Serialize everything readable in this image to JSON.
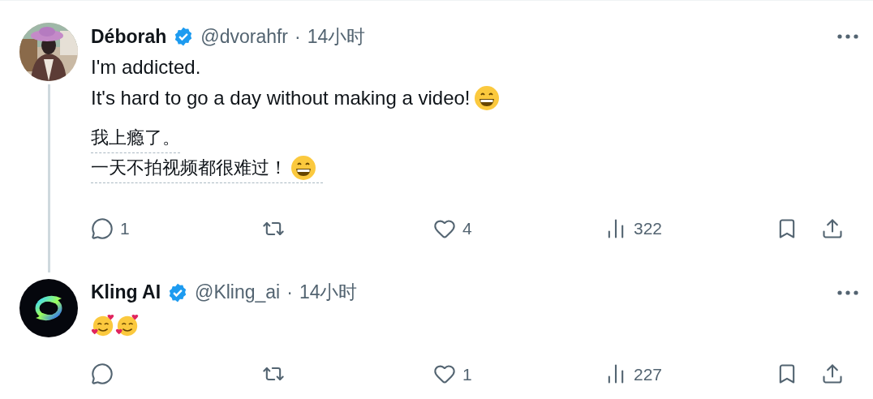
{
  "tweets": [
    {
      "avatar": {
        "kind": "picture"
      },
      "name": "Déborah",
      "verified": true,
      "handle": "@dvorahfr",
      "separator": "·",
      "time": "14小时",
      "thread_line": true,
      "body": [
        [
          {
            "kind": "text",
            "text": "I'm addicted."
          }
        ],
        [
          {
            "kind": "text",
            "text": "It's hard to go a day without making a video!"
          },
          {
            "kind": "grin_emoji"
          }
        ]
      ],
      "translation": [
        [
          {
            "kind": "text",
            "text": "我上瘾了。"
          }
        ],
        [
          {
            "kind": "text",
            "text": "一天不拍视频都很难过！"
          },
          {
            "kind": "grin_emoji"
          }
        ]
      ],
      "actions": [
        {
          "kind": "reply",
          "count": "1"
        },
        {
          "kind": "repost"
        },
        {
          "kind": "like",
          "count": "4"
        },
        {
          "kind": "views",
          "count": "322"
        },
        {
          "kind": "bookmark"
        },
        {
          "kind": "share"
        }
      ]
    },
    {
      "avatar": {
        "kind": "logo"
      },
      "name": "Kling AI",
      "verified": true,
      "handle": "@Kling_ai",
      "separator": "·",
      "time": "14小时",
      "thread_line": false,
      "body": [
        [
          {
            "kind": "hearts_emoji"
          },
          {
            "kind": "hearts_emoji"
          }
        ]
      ],
      "actions": [
        {
          "kind": "reply"
        },
        {
          "kind": "repost"
        },
        {
          "kind": "like",
          "count": "1"
        },
        {
          "kind": "views",
          "count": "227"
        },
        {
          "kind": "bookmark"
        },
        {
          "kind": "share"
        }
      ]
    }
  ]
}
